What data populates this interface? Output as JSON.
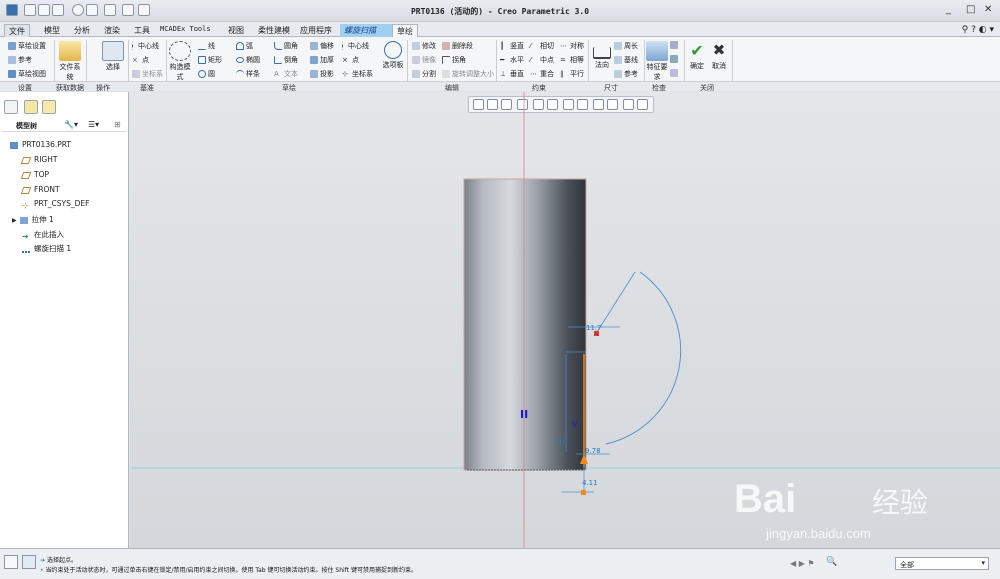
{
  "title": "PRT0136 (活动的) - Creo Parametric 3.0",
  "tabs": [
    "文件",
    "模型",
    "分析",
    "渲染",
    "工具",
    "MCADEx Tools",
    "视图",
    "柔性建模",
    "应用程序",
    "螺旋扫描",
    "草绘"
  ],
  "ribbon": {
    "setup": [
      "草绘设置",
      "参考",
      "草绘视图"
    ],
    "file_system": "文件系统",
    "select": "选择",
    "datum": [
      "中心线",
      "点",
      "坐标系"
    ],
    "construction_mode": "构造模式",
    "sketch": [
      "线",
      "弧",
      "圆角",
      "偏移",
      "中心线",
      "矩形",
      "椭圆",
      "倒角",
      "加厚",
      "点",
      "圆",
      "样条",
      "文本",
      "投影",
      "坐标系",
      "选项板"
    ],
    "edit": [
      "修改",
      "删除段",
      "镜像",
      "拐角",
      "分割",
      "旋转调整大小"
    ],
    "constrain": [
      "竖直",
      "相切",
      "对称",
      "水平",
      "中点",
      "相等",
      "垂直",
      "重合",
      "平行"
    ],
    "dimension": [
      "法向",
      "周长",
      "基线",
      "参考"
    ],
    "inspect": "特征要求",
    "ok": "确定",
    "cancel": "取消"
  },
  "groups": [
    "设置",
    "获取数据",
    "操作",
    "基准",
    "草绘",
    "编辑",
    "约束",
    "尺寸",
    "检查",
    "关闭"
  ],
  "tree": {
    "header": "模型树",
    "items": [
      "PRT0136.PRT",
      "RIGHT",
      "TOP",
      "FRONT",
      "PRT_CSYS_DEF",
      "拉伸 1",
      "在此插入",
      "螺旋扫描 1"
    ]
  },
  "sketch_dims": {
    "d1": "11.7",
    "d2": "114",
    "d3": "9.78",
    "d4": "4.11",
    "v": "V",
    "h": "H"
  },
  "status": {
    "line1": "选择起点。",
    "line2": "当约束处于活动状态时，可通过单击右键在锁定/禁用/启用约束之间切换。使用 Tab 键可切换活动约束。按住 Shift 键可禁用捕捉到新约束。",
    "filter": "全部"
  },
  "watermark": {
    "brand": "Bai",
    "cn": "经验",
    "url": "jingyan.baidu.com"
  }
}
